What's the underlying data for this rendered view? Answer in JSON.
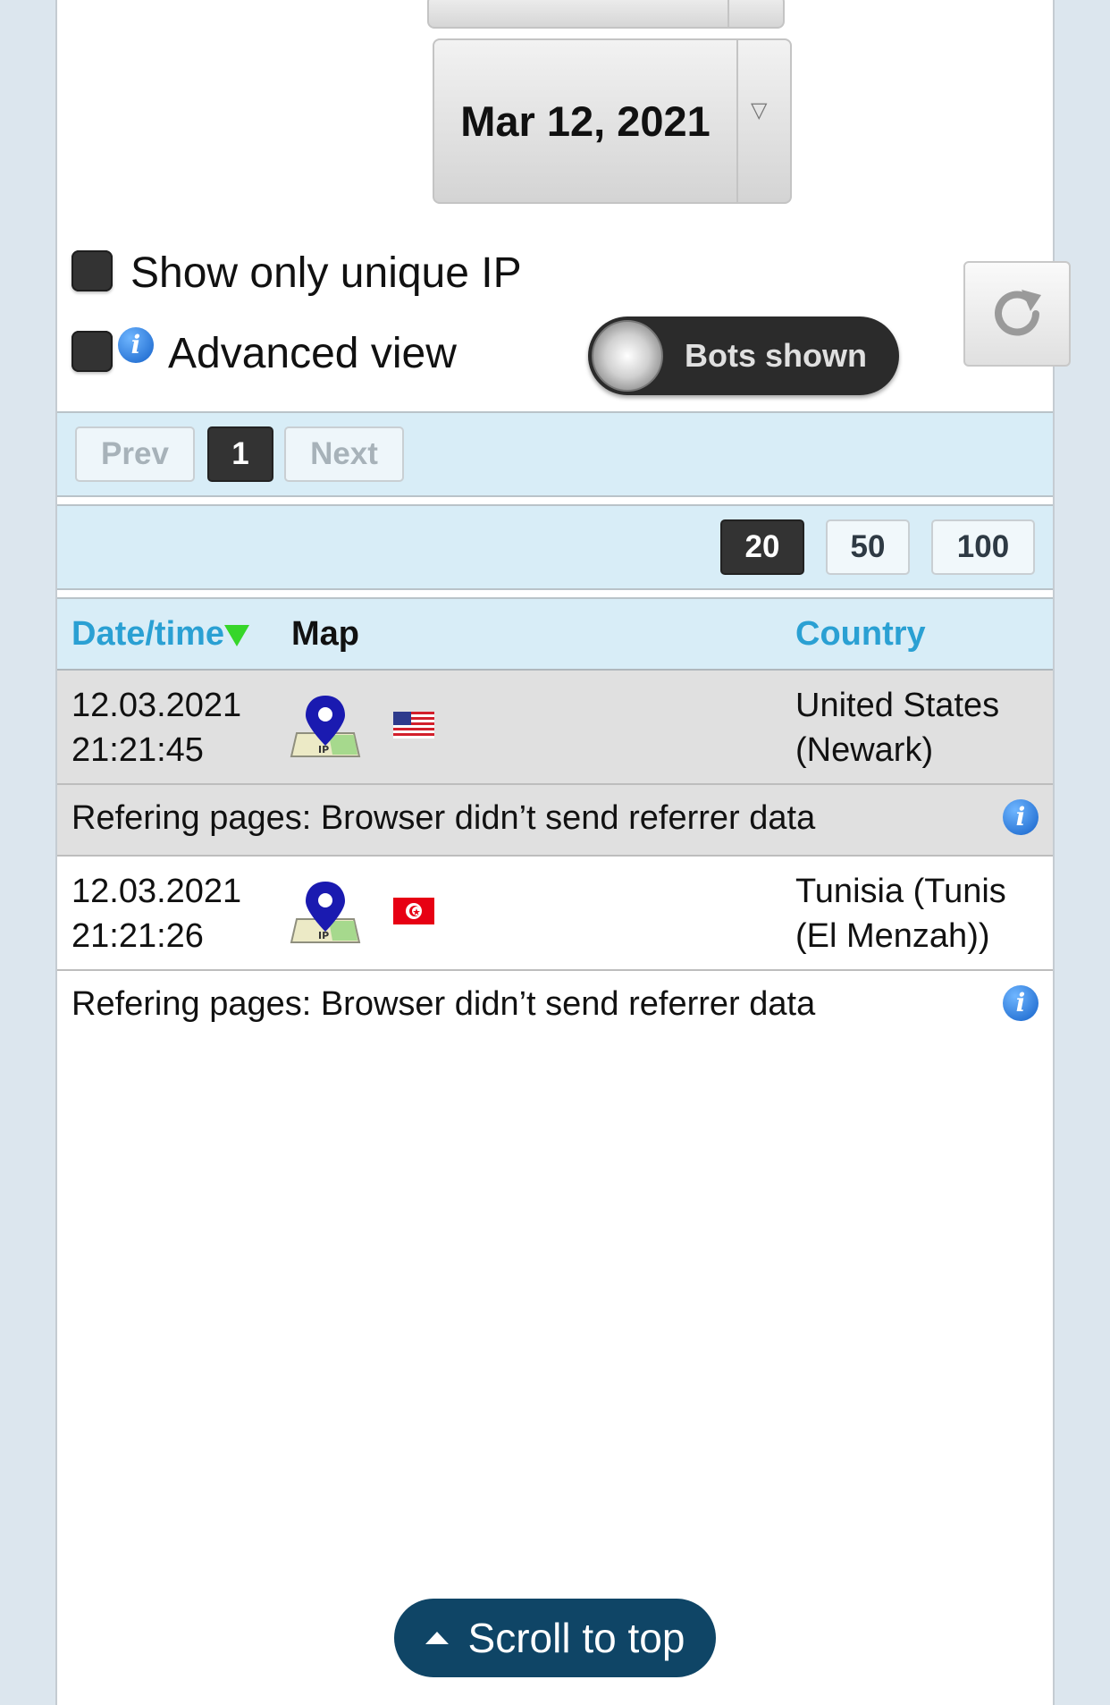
{
  "date_picker": {
    "value": "Mar 12, 2021",
    "arrow": "▽"
  },
  "options": {
    "unique_ip_label": "Show only unique IP",
    "advanced_view_label": "Advanced view",
    "bots_toggle_label": "Bots shown",
    "info_glyph": "i"
  },
  "pagination": {
    "prev": "Prev",
    "current": "1",
    "next": "Next"
  },
  "page_sizes": [
    "20",
    "50",
    "100"
  ],
  "table": {
    "headers": {
      "datetime": "Date/time",
      "map": "Map",
      "country": "Country"
    },
    "rows": [
      {
        "date": "12.03.2021",
        "time": "21:21:45",
        "country_line1": "United States",
        "country_line2": "(Newark)",
        "flag": "us-flag",
        "referrer": "Refering pages: Browser didn’t send referrer data"
      },
      {
        "date": "12.03.2021",
        "time": "21:21:26",
        "country_line1": "Tunisia (Tunis",
        "country_line2": "(El Menzah))",
        "flag": "tunisia-flag",
        "referrer": "Refering pages: Browser didn’t send referrer data"
      }
    ]
  },
  "scroll_to_top": {
    "label": "Scroll to top"
  },
  "colors": {
    "header_link": "#2aa0d3",
    "sort_arrow": "#36d62a",
    "bar_bg": "#d8edf7",
    "scroll_button": "#0f4566"
  }
}
